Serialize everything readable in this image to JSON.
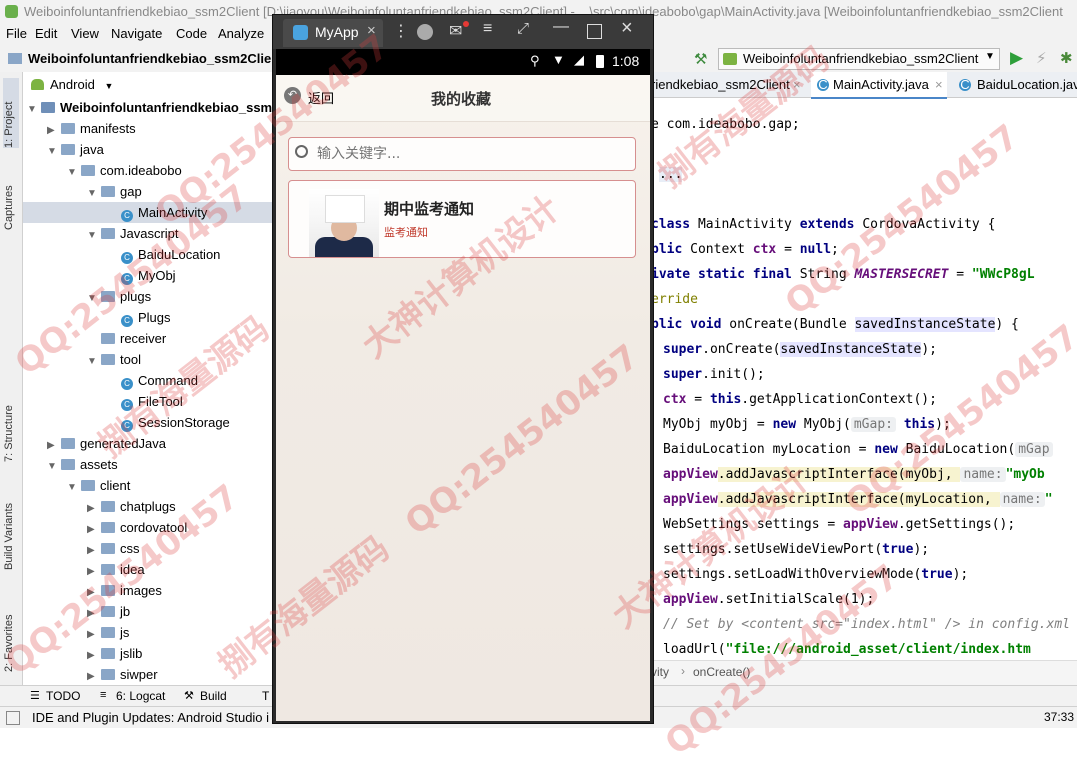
{
  "ide": {
    "title": "Weiboinfoluntanfriendkebiao_ssm2Client [D:\\jiaoyou\\Weiboinfoluntanfriendkebiao_ssm2Client] - ...\\src\\com\\ideabobo\\gap\\MainActivity.java [Weiboinfoluntanfriendkebiao_ssm2Client",
    "menu": [
      "File",
      "Edit",
      "View",
      "Navigate",
      "Code",
      "Analyze"
    ],
    "project_name": "Weiboinfoluntanfriendkebiao_ssm2Client",
    "run_config": "Weiboinfoluntanfriendkebiao_ssm2Client",
    "view_selector": "Android",
    "left_tabs": [
      "1: Project",
      "Captures",
      "7: Structure",
      "Build Variants",
      "2: Favorites"
    ],
    "tree": [
      {
        "label": "Weiboinfoluntanfriendkebiao_ssm",
        "type": "module",
        "expanded": true
      },
      {
        "label": "manifests",
        "type": "folder",
        "expanded": false
      },
      {
        "label": "java",
        "type": "folder",
        "expanded": true
      },
      {
        "label": "com.ideabobo",
        "type": "folder",
        "expanded": true
      },
      {
        "label": "gap",
        "type": "folder",
        "expanded": true
      },
      {
        "label": "MainActivity",
        "type": "class",
        "selected": true
      },
      {
        "label": "Javascript",
        "type": "folder",
        "expanded": true
      },
      {
        "label": "BaiduLocation",
        "type": "class"
      },
      {
        "label": "MyObj",
        "type": "class"
      },
      {
        "label": "plugs",
        "type": "folder",
        "expanded": true
      },
      {
        "label": "Plugs",
        "type": "class"
      },
      {
        "label": "receiver",
        "type": "folder"
      },
      {
        "label": "tool",
        "type": "folder",
        "expanded": true
      },
      {
        "label": "Command",
        "type": "class"
      },
      {
        "label": "FileTool",
        "type": "class"
      },
      {
        "label": "SessionStorage",
        "type": "class"
      },
      {
        "label": "generatedJava",
        "type": "folder",
        "expanded": false
      },
      {
        "label": "assets",
        "type": "folder",
        "expanded": true
      },
      {
        "label": "client",
        "type": "folder",
        "expanded": true
      },
      {
        "label": "chatplugs",
        "type": "folder",
        "expanded": false
      },
      {
        "label": "cordovatool",
        "type": "folder",
        "expanded": false
      },
      {
        "label": "css",
        "type": "folder",
        "expanded": false
      },
      {
        "label": "idea",
        "type": "folder",
        "expanded": false
      },
      {
        "label": "images",
        "type": "folder",
        "expanded": false
      },
      {
        "label": "jb",
        "type": "folder",
        "expanded": false
      },
      {
        "label": "js",
        "type": "folder",
        "expanded": false
      },
      {
        "label": "jslib",
        "type": "folder",
        "expanded": false
      },
      {
        "label": "siwper",
        "type": "folder",
        "expanded": false
      }
    ],
    "editor_tabs": [
      "riendkebiao_ssm2Client",
      "MainActivity.java",
      "BaiduLocation.java"
    ],
    "code": {
      "l1": "e com.ideabobo.gap;",
      "l2": "...",
      "l3a": "class",
      "l3b": " MainActivity ",
      "l3c": "extends",
      "l3d": " CordovaActivity {",
      "l4a": "blic",
      "l4b": " Context ",
      "l4c": "ctx",
      "l4d": " = ",
      "l4e": "null",
      "l4f": ";",
      "l5a": "ivate static final",
      "l5b": " String ",
      "l5c": "MASTERSECRET",
      "l5d": " = ",
      "l5e": "\"WWcP8gL",
      "l6": "erride",
      "l7a": "blic void",
      "l7b": " onCreate(Bundle ",
      "l7c": "savedInstanceState",
      "l7d": ") {",
      "l8a": "super",
      "l8b": ".onCreate(",
      "l8c": "savedInstanceState",
      "l8d": ");",
      "l9a": "super",
      "l9b": ".init();",
      "l10a": "ctx",
      "l10b": " = ",
      "l10c": "this",
      "l10d": ".getApplicationContext();",
      "l11a": "MyObj myObj = ",
      "l11b": "new",
      "l11c": " MyObj(",
      "l11d": "mGap:",
      "l11e": "this",
      "l11f": ");",
      "l12a": "BaiduLocation myLocation = ",
      "l12b": "new",
      "l12c": " BaiduLocation(",
      "l12d": "mGap",
      "l13a": "appView",
      "l13b": ".addJavascriptInterface(myObj,  ",
      "l13c": "name:",
      "l13d": "\"myOb",
      "l14a": "appView",
      "l14b": ".addJavascriptInterface(myLocation,  ",
      "l14c": "name:",
      "l14d": "\"",
      "l15a": "WebSettings settings = ",
      "l15b": "appView",
      "l15c": ".getSettings();",
      "l16a": "settings.setUseWideViewPort(",
      "l16b": "true",
      "l16c": ");",
      "l17a": "settings.setLoadWithOverviewMode(",
      "l17b": "true",
      "l17c": ");",
      "l18a": "appView",
      "l18b": ".setInitialScale(1);",
      "l19": "// Set by <content src=\"index.html\" /> in config.xml",
      "l20a": "loadUrl(",
      "l20b": "\"file:///android_asset/client/index.htm"
    },
    "breadcrumb": [
      "vity",
      "onCreate()"
    ],
    "bottom_tools": [
      "TODO",
      "6: Logcat",
      "Build",
      "T"
    ],
    "status_text": "IDE and Plugin Updates: Android Studio i",
    "cursor_pos": "37:33"
  },
  "emulator": {
    "tab_title": "MyApp",
    "clock": "1:08",
    "app": {
      "back_label": "返回",
      "page_title": "我的收藏",
      "search_placeholder": "输入关键字...",
      "item_title": "期中监考通知",
      "item_tag": "监考通知"
    }
  },
  "watermarks": [
    "QQ:254540457",
    "捌有海量源码",
    "大神计算机设计"
  ],
  "colors": {
    "accent_red": "#c0392b",
    "card_border": "#d68f8f",
    "run_green": "#2e9f3a",
    "selection": "#d5dbe5"
  }
}
